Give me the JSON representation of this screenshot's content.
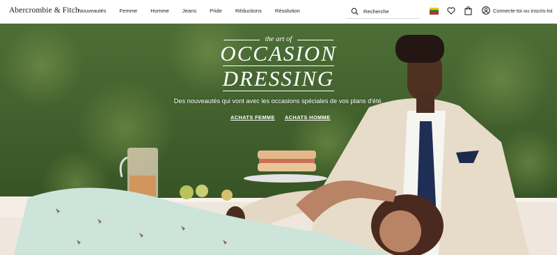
{
  "header": {
    "logo": "Abercrombie & Fitch",
    "nav": [
      "Nouveautés",
      "Femme",
      "Homme",
      "Jeans",
      "Pride",
      "Réductions",
      "Résolution"
    ],
    "search_placeholder": "Recherche",
    "signin": "Connecte-toi ou inscris-toi",
    "icons": [
      "search-icon",
      "flag-icon",
      "heart-icon",
      "bag-icon",
      "user-icon"
    ]
  },
  "hero": {
    "art_of": "the art of",
    "line1": "OCCASION",
    "line2": "DRESSING",
    "tagline": "Des nouveautés qui vont avec les occasions spéciales de vos plans d'été.",
    "cta_women": "ACHATS FEMME",
    "cta_men": "ACHATS HOMME"
  },
  "colors": {
    "hedge": "#3f5e2c",
    "suit": "#e6dccb",
    "tablecloth": "#f3ece4",
    "dress": "#c9e3d8",
    "tie": "#1f2e55"
  }
}
